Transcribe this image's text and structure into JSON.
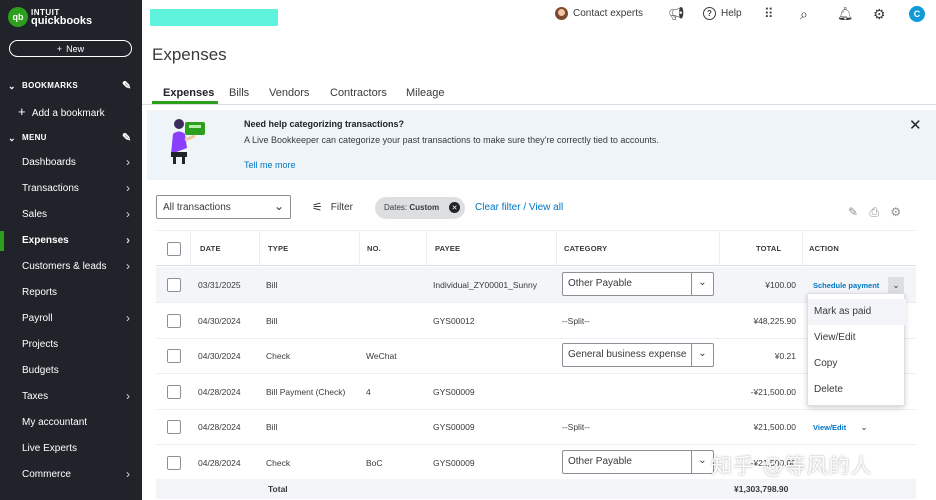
{
  "brand": {
    "logo_badge": "qb",
    "logo_line1": "INTUIT",
    "logo_line2": "quickbooks"
  },
  "sidebar": {
    "new_label": "New",
    "bookmarks_label": "BOOKMARKS",
    "add_bookmark_label": "Add a bookmark",
    "menu_label": "MENU",
    "items": [
      {
        "label": "Dashboards",
        "arrow": true
      },
      {
        "label": "Transactions",
        "arrow": true
      },
      {
        "label": "Sales",
        "arrow": true
      },
      {
        "label": "Expenses",
        "arrow": true,
        "active": true
      },
      {
        "label": "Customers & leads",
        "arrow": true
      },
      {
        "label": "Reports",
        "arrow": false
      },
      {
        "label": "Payroll",
        "arrow": true
      },
      {
        "label": "Projects",
        "arrow": false
      },
      {
        "label": "Budgets",
        "arrow": false
      },
      {
        "label": "Taxes",
        "arrow": true
      },
      {
        "label": "My accountant",
        "arrow": false
      },
      {
        "label": "Live Experts",
        "arrow": false
      },
      {
        "label": "Commerce",
        "arrow": true
      }
    ]
  },
  "topbar": {
    "contact_label": "Contact experts",
    "help_label": "Help",
    "user_initial": "C",
    "icons": [
      "megaphone-icon",
      "apps-grid-icon",
      "search-icon",
      "bell-icon",
      "gear-icon"
    ]
  },
  "page": {
    "title": "Expenses"
  },
  "tabs": [
    "Expenses",
    "Bills",
    "Vendors",
    "Contractors",
    "Mileage"
  ],
  "banner": {
    "title": "Need help categorizing transactions?",
    "text": "A Live Bookkeeper can categorize your past transactions to make sure they're correctly tied to accounts.",
    "link": "Tell me more"
  },
  "filters": {
    "select_value": "All transactions",
    "filter_label": "Filter",
    "chip_prefix": "Dates:",
    "chip_value": "Custom",
    "clear_link": "Clear filter / View all"
  },
  "table": {
    "headers": [
      "DATE",
      "TYPE",
      "NO.",
      "PAYEE",
      "CATEGORY",
      "TOTAL",
      "ACTION"
    ],
    "rows": [
      {
        "date": "03/31/2025",
        "type": "Bill",
        "no": "",
        "payee": "Individual_ZY00001_Sunny",
        "category": "Other Payable",
        "category_select": true,
        "total": "¥100.00",
        "action": "Schedule payment"
      },
      {
        "date": "04/30/2024",
        "type": "Bill",
        "no": "",
        "payee": "GYS00012",
        "category": "--Split--",
        "category_select": false,
        "total": "¥48,225.90",
        "action": ""
      },
      {
        "date": "04/30/2024",
        "type": "Check",
        "no": "WeChat",
        "payee": "",
        "category": "General business expense",
        "category_select": true,
        "total": "¥0.21",
        "action": ""
      },
      {
        "date": "04/28/2024",
        "type": "Bill Payment (Check)",
        "no": "4",
        "payee": "GYS00009",
        "category": "",
        "category_select": false,
        "total": "-¥21,500.00",
        "action": ""
      },
      {
        "date": "04/28/2024",
        "type": "Bill",
        "no": "",
        "payee": "GYS00009",
        "category": "--Split--",
        "category_select": false,
        "total": "¥21,500.00",
        "action": "View/Edit"
      },
      {
        "date": "04/28/2024",
        "type": "Check",
        "no": "BoC",
        "payee": "GYS00009",
        "category": "Other Payable",
        "category_select": true,
        "total": "-¥21,500.00",
        "action": ""
      }
    ],
    "total_label": "Total",
    "total_value": "¥1,303,798.90"
  },
  "action_menu": [
    "Mark as paid",
    "View/Edit",
    "Copy",
    "Delete"
  ],
  "watermark": "知乎 @等风的人"
}
